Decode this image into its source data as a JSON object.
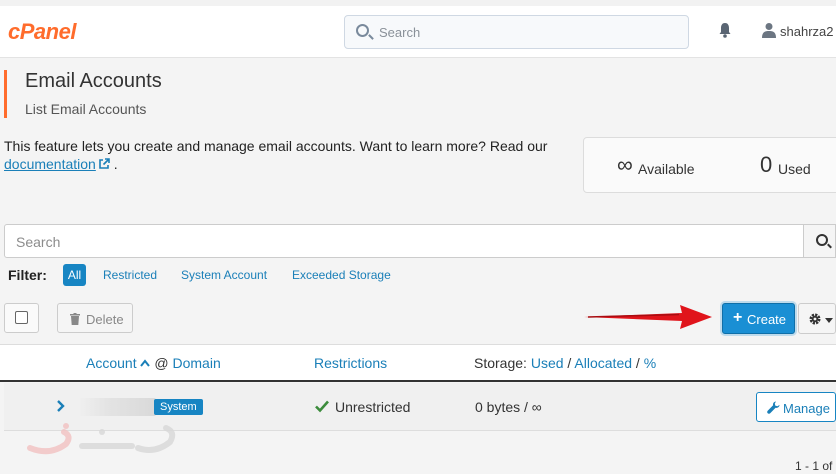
{
  "header": {
    "logo": "cPanel",
    "search_placeholder": "Search",
    "username": "shahrza2"
  },
  "page": {
    "title": "Email Accounts",
    "subtitle": "List Email Accounts",
    "intro_text": "This feature lets you create and manage email accounts. Want to learn more? Read our ",
    "doc_link": "documentation",
    "intro_end": "."
  },
  "stats": {
    "available_value": "∞",
    "available_label": "Available",
    "used_value": "0",
    "used_label": "Used"
  },
  "search": {
    "placeholder": "Search"
  },
  "filter": {
    "label": "Filter:",
    "options": [
      "All",
      "Restricted",
      "System Account",
      "Exceeded Storage"
    ]
  },
  "toolbar": {
    "delete_label": "Delete",
    "create_label": "Create"
  },
  "table": {
    "col_account": "Account",
    "col_at": "@",
    "col_domain": "Domain",
    "col_restrictions": "Restrictions",
    "col_storage_prefix": "Storage:",
    "col_storage_used": "Used",
    "col_storage_sep1": "/",
    "col_storage_allocated": "Allocated",
    "col_storage_sep2": "/",
    "col_storage_pct": "%",
    "rows": [
      {
        "badge": "System",
        "restriction": "Unrestricted",
        "storage": "0 bytes / ∞",
        "action": "Manage"
      }
    ]
  },
  "pager": "1 - 1 of",
  "colors": {
    "accent": "#1785c3",
    "brand": "#ff6c2c",
    "arrow": "#e0141b"
  }
}
